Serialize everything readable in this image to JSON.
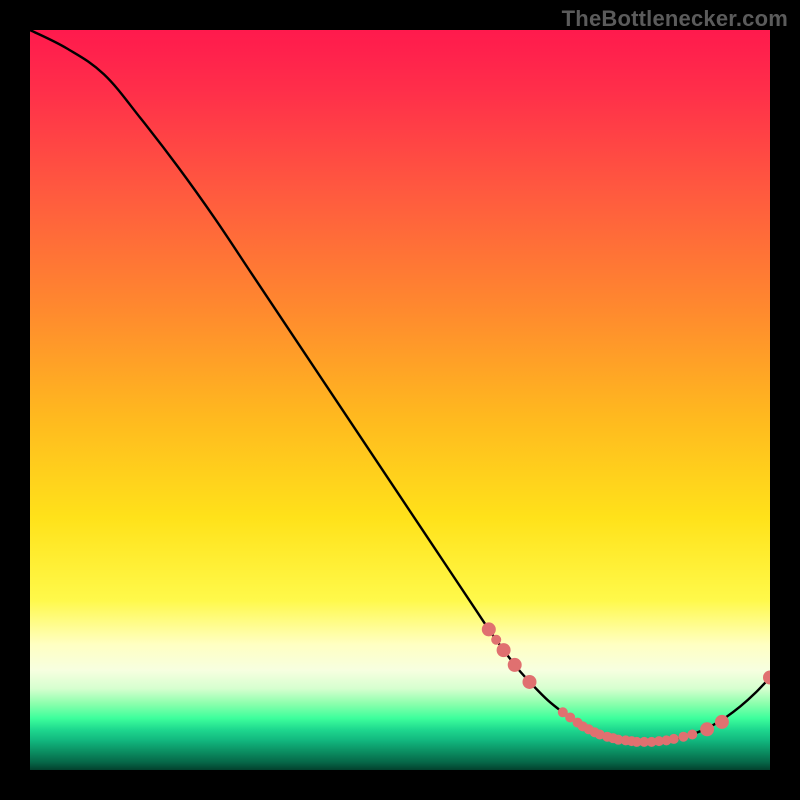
{
  "watermark": "TheBottlenecker.com",
  "chart_data": {
    "type": "line",
    "title": "",
    "xlabel": "",
    "ylabel": "",
    "xlim": [
      0,
      100
    ],
    "ylim": [
      0,
      100
    ],
    "series": [
      {
        "name": "curve",
        "x": [
          0,
          5,
          10,
          15,
          20,
          25,
          30,
          35,
          40,
          45,
          50,
          55,
          60,
          62,
          64,
          66,
          68,
          70,
          72,
          74,
          76,
          78,
          80,
          82,
          84,
          86,
          88,
          90,
          92,
          94,
          96,
          98,
          100
        ],
        "y": [
          100,
          97.5,
          94,
          88,
          81.5,
          74.5,
          67,
          59.5,
          52,
          44.5,
          37,
          29.5,
          22,
          19,
          16.2,
          13.6,
          11.4,
          9.4,
          7.8,
          6.4,
          5.3,
          4.5,
          4.0,
          3.8,
          3.8,
          4.0,
          4.4,
          5.0,
          5.9,
          7.1,
          8.6,
          10.4,
          12.5
        ]
      }
    ],
    "markers": {
      "name": "highlight-points",
      "color": "#e07070",
      "radius_small": 5,
      "radius_large": 7,
      "points": [
        {
          "x": 62.0,
          "y": 19.0,
          "r": "large"
        },
        {
          "x": 63.0,
          "y": 17.6,
          "r": "small"
        },
        {
          "x": 64.0,
          "y": 16.2,
          "r": "large"
        },
        {
          "x": 65.5,
          "y": 14.2,
          "r": "large"
        },
        {
          "x": 67.5,
          "y": 11.9,
          "r": "large"
        },
        {
          "x": 72.0,
          "y": 7.8,
          "r": "small"
        },
        {
          "x": 73.0,
          "y": 7.1,
          "r": "small"
        },
        {
          "x": 74.0,
          "y": 6.4,
          "r": "small"
        },
        {
          "x": 74.7,
          "y": 5.9,
          "r": "small"
        },
        {
          "x": 75.5,
          "y": 5.5,
          "r": "small"
        },
        {
          "x": 76.3,
          "y": 5.1,
          "r": "small"
        },
        {
          "x": 77.0,
          "y": 4.8,
          "r": "small"
        },
        {
          "x": 78.0,
          "y": 4.5,
          "r": "small"
        },
        {
          "x": 78.8,
          "y": 4.3,
          "r": "small"
        },
        {
          "x": 79.5,
          "y": 4.1,
          "r": "small"
        },
        {
          "x": 80.5,
          "y": 4.0,
          "r": "small"
        },
        {
          "x": 81.3,
          "y": 3.9,
          "r": "small"
        },
        {
          "x": 82.0,
          "y": 3.8,
          "r": "small"
        },
        {
          "x": 83.0,
          "y": 3.8,
          "r": "small"
        },
        {
          "x": 84.0,
          "y": 3.8,
          "r": "small"
        },
        {
          "x": 85.0,
          "y": 3.9,
          "r": "small"
        },
        {
          "x": 86.0,
          "y": 4.0,
          "r": "small"
        },
        {
          "x": 87.0,
          "y": 4.2,
          "r": "small"
        },
        {
          "x": 88.3,
          "y": 4.5,
          "r": "small"
        },
        {
          "x": 89.5,
          "y": 4.8,
          "r": "small"
        },
        {
          "x": 91.5,
          "y": 5.5,
          "r": "large"
        },
        {
          "x": 93.5,
          "y": 6.5,
          "r": "large"
        },
        {
          "x": 100.0,
          "y": 12.5,
          "r": "large"
        }
      ]
    }
  }
}
